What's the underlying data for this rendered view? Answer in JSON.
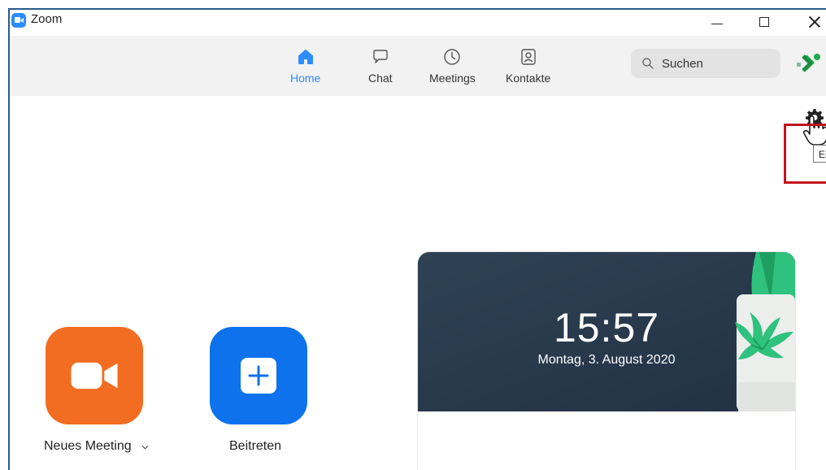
{
  "window": {
    "title": "Zoom"
  },
  "nav": {
    "tabs": [
      {
        "label": "Home",
        "icon": "home-icon",
        "active": true
      },
      {
        "label": "Chat",
        "icon": "chat-icon",
        "active": false
      },
      {
        "label": "Meetings",
        "icon": "clock-icon",
        "active": false
      },
      {
        "label": "Kontakte",
        "icon": "contact-icon",
        "active": false
      }
    ],
    "search": {
      "placeholder": "Suchen"
    }
  },
  "settings": {
    "tooltip": "Ei"
  },
  "actions": {
    "new_meeting": "Neues Meeting",
    "join": "Beitreten"
  },
  "clock": {
    "time": "15:57",
    "date": "Montag, 3. August 2020"
  },
  "colors": {
    "accent": "#2d8cff",
    "new_meeting_tile": "#f26d21",
    "join_tile": "#0e72ed",
    "highlight": "#c0151d",
    "status_green": "#1ea94a"
  }
}
